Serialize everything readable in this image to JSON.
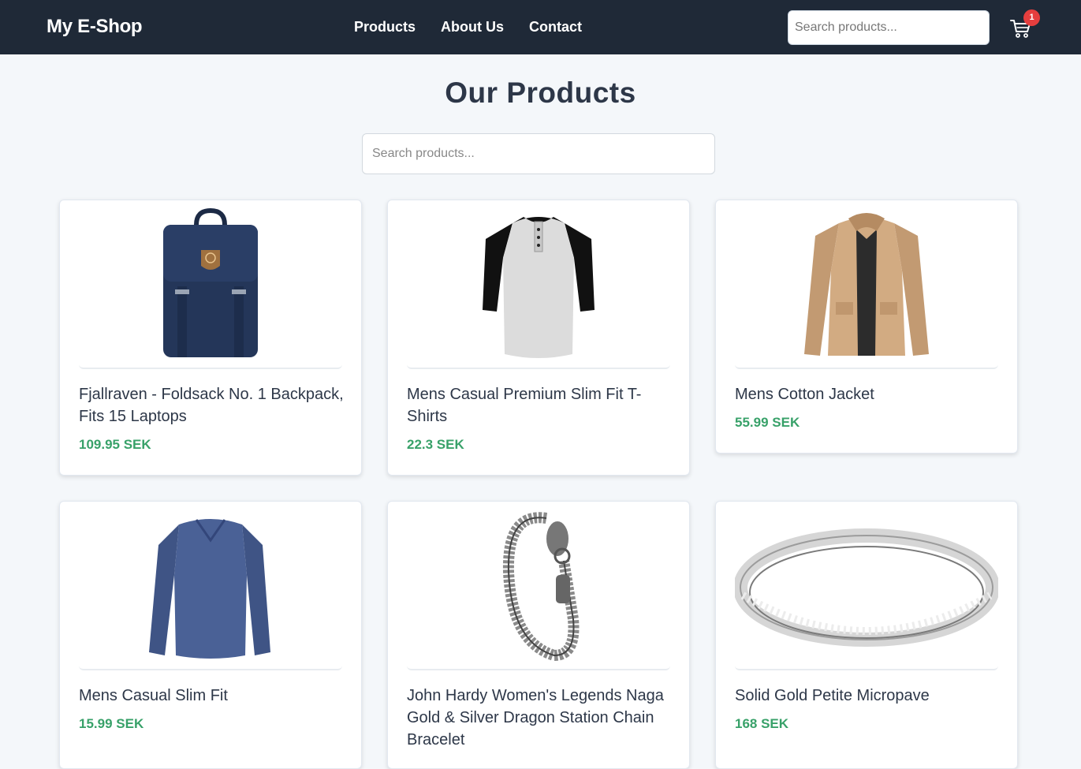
{
  "header": {
    "brand": "My E-Shop",
    "nav": [
      "Products",
      "About Us",
      "Contact"
    ],
    "search_placeholder": "Search products...",
    "cart_count": "1"
  },
  "main": {
    "title": "Our Products",
    "search_placeholder": "Search products..."
  },
  "products": [
    {
      "title": "Fjallraven - Foldsack No. 1 Backpack, Fits 15 Laptops",
      "price": "109.95 SEK",
      "icon": "backpack-image"
    },
    {
      "title": "Mens Casual Premium Slim Fit T-Shirts",
      "price": "22.3 SEK",
      "icon": "tshirt-image"
    },
    {
      "title": "Mens Cotton Jacket",
      "price": "55.99 SEK",
      "icon": "jacket-image"
    },
    {
      "title": "Mens Casual Slim Fit",
      "price": "15.99 SEK",
      "icon": "longsleeve-image"
    },
    {
      "title": "John Hardy Women's Legends Naga Gold & Silver Dragon Station Chain Bracelet",
      "price": "",
      "icon": "bracelet-image"
    },
    {
      "title": "Solid Gold Petite Micropave",
      "price": "168 SEK",
      "icon": "ring-image"
    }
  ],
  "colors": {
    "navbar": "#1f2937",
    "price": "#38a169",
    "badge": "#e53e3e",
    "background": "#f4f7fa"
  }
}
